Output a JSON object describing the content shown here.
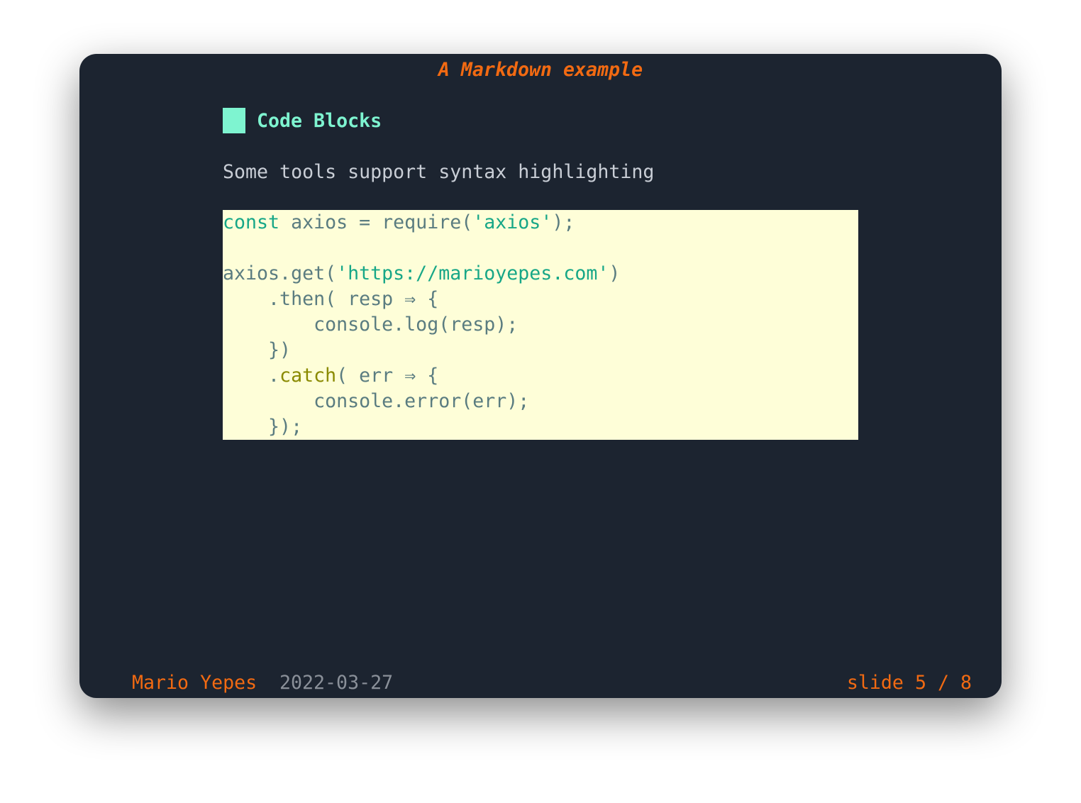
{
  "presentation": {
    "title": "A Markdown example",
    "heading": "Code Blocks",
    "paragraph": "Some tools support syntax highlighting",
    "code_lines": [
      [
        {
          "t": "const",
          "k": "keyword"
        },
        {
          "t": " axios = require(",
          "k": "plain"
        },
        {
          "t": "'axios'",
          "k": "string"
        },
        {
          "t": ");",
          "k": "plain"
        }
      ],
      [],
      [
        {
          "t": "axios.get(",
          "k": "plain"
        },
        {
          "t": "'https://marioyepes.com'",
          "k": "string"
        },
        {
          "t": ")",
          "k": "plain"
        }
      ],
      [
        {
          "t": "    .then( resp ⇒ {",
          "k": "plain"
        }
      ],
      [
        {
          "t": "        console.log(resp);",
          "k": "plain"
        }
      ],
      [
        {
          "t": "    })",
          "k": "plain"
        }
      ],
      [
        {
          "t": "    .",
          "k": "plain"
        },
        {
          "t": "catch",
          "k": "function"
        },
        {
          "t": "( err ⇒ {",
          "k": "plain"
        }
      ],
      [
        {
          "t": "        console.error(err);",
          "k": "plain"
        }
      ],
      [
        {
          "t": "    });",
          "k": "plain"
        }
      ]
    ],
    "footer": {
      "author": "Mario Yepes",
      "date": "2022-03-27",
      "slide": "slide 5 / 8"
    }
  },
  "colors": {
    "background": "#1c2430",
    "accent": "#f26a12",
    "heading": "#7ef4d0",
    "code_bg": "#fefed8"
  }
}
